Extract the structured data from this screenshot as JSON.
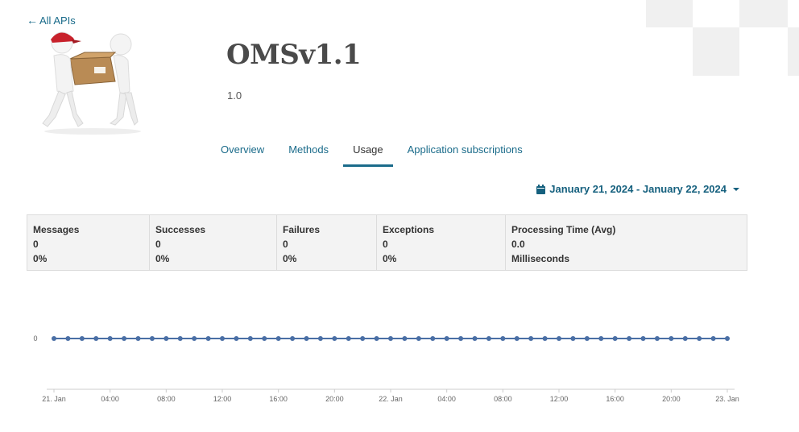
{
  "nav": {
    "back_label": "All APIs"
  },
  "api": {
    "title": "OMSv1.1",
    "version": "1.0",
    "logo": "delivery-people-carrying-box-icon"
  },
  "tabs": [
    {
      "label": "Overview",
      "active": false
    },
    {
      "label": "Methods",
      "active": false
    },
    {
      "label": "Usage",
      "active": true
    },
    {
      "label": "Application subscriptions",
      "active": false
    }
  ],
  "date_range": {
    "label": "January 21, 2024 - January 22, 2024",
    "icon": "calendar-icon"
  },
  "stats": [
    {
      "title": "Messages",
      "value": "0",
      "sub": "0%"
    },
    {
      "title": "Successes",
      "value": "0",
      "sub": "0%"
    },
    {
      "title": "Failures",
      "value": "0",
      "sub": "0%"
    },
    {
      "title": "Exceptions",
      "value": "0",
      "sub": "0%"
    },
    {
      "title": "Processing Time (Avg)",
      "value": "0.0",
      "sub": "Milliseconds"
    }
  ],
  "chart_data": {
    "type": "line",
    "x_tick_labels": [
      "21. Jan",
      "04:00",
      "08:00",
      "12:00",
      "16:00",
      "20:00",
      "22. Jan",
      "04:00",
      "08:00",
      "12:00",
      "16:00",
      "20:00",
      "23. Jan"
    ],
    "y_tick_labels": [
      "0"
    ],
    "x_range_hours": [
      0,
      48
    ],
    "point_interval_hours": 1,
    "values": [
      0,
      0,
      0,
      0,
      0,
      0,
      0,
      0,
      0,
      0,
      0,
      0,
      0,
      0,
      0,
      0,
      0,
      0,
      0,
      0,
      0,
      0,
      0,
      0,
      0,
      0,
      0,
      0,
      0,
      0,
      0,
      0,
      0,
      0,
      0,
      0,
      0,
      0,
      0,
      0,
      0,
      0,
      0,
      0,
      0,
      0,
      0,
      0,
      0
    ],
    "series_color": "#4a6fa5"
  }
}
